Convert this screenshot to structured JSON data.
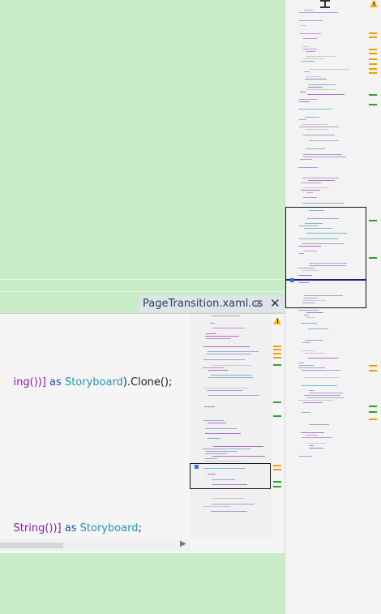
{
  "document_tab": {
    "title": "PageTransition.xaml.cs",
    "pin_glyph": "⍓",
    "close_glyph": "✕"
  },
  "editor": {
    "line1": {
      "t1": "ing())]",
      "t2": " as ",
      "t3": "Storyboard",
      "t4": ").Clone();"
    },
    "line2": {
      "t1": "String())]",
      "t2": " as ",
      "t3": "Storyboard",
      "t4": ";"
    }
  },
  "icons": {
    "warning": "warning-icon",
    "splitter": "splitter-icon",
    "pin": "pin-icon",
    "close": "close-icon",
    "scroll_right": "scroll-right-arrow-icon"
  },
  "colors": {
    "background": "#c8ecc8",
    "accent_orange": "#f0a000",
    "accent_green": "#2ea02e",
    "viewport_line": "#1a1a8c",
    "caret": "#2a7ae2"
  }
}
